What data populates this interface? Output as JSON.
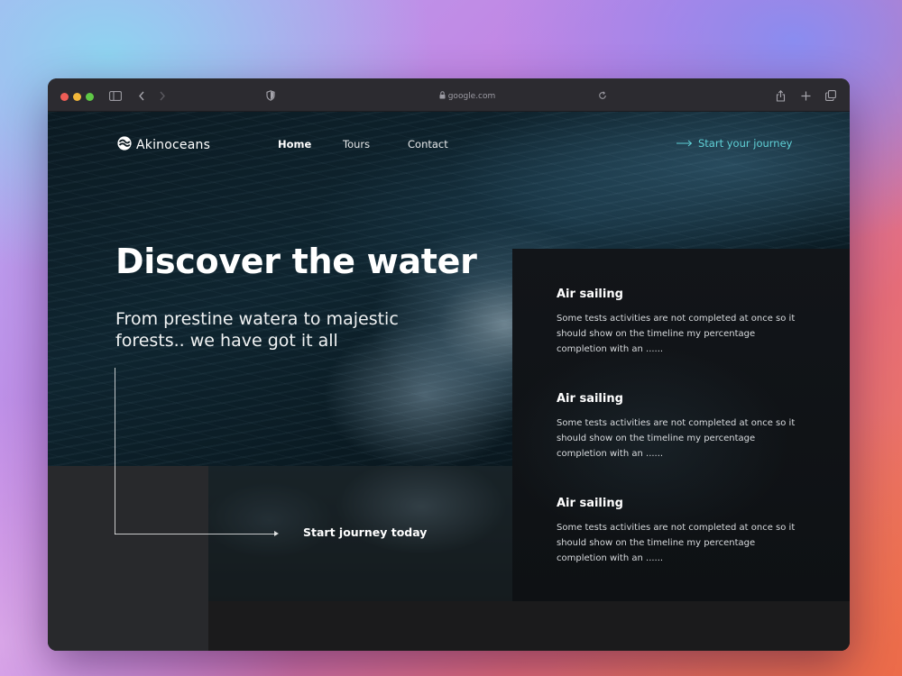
{
  "browser": {
    "url": "google.com",
    "icons": [
      "sidebar-icon",
      "back-icon",
      "forward-icon",
      "shield-icon",
      "lock-icon",
      "reload-icon",
      "share-icon",
      "new-tab-icon",
      "tabs-overview-icon"
    ]
  },
  "site": {
    "brand": "Akinoceans",
    "nav": {
      "home": "Home",
      "tours": "Tours",
      "contact": "Contact"
    },
    "cta_top": "Start your journey",
    "hero_title": "Discover the water",
    "hero_subtitle": "From prestine watera to majestic forests.. we have got it all",
    "start_link": "Start journey today",
    "activities": [
      {
        "title": "Air sailing",
        "text": "Some tests activities are not completed at once so it should show on the timeline my percentage completion with an ......"
      },
      {
        "title": "Air sailing",
        "text": "Some tests activities are not completed at once so it should show on the timeline my percentage completion with an ......"
      },
      {
        "title": "Air sailing",
        "text": "Some tests activities are not completed at once so it should show on the timeline my percentage completion with an ......"
      }
    ]
  },
  "colors": {
    "accent": "#5fd0d6",
    "window_bg": "#151618",
    "titlebar": "#2c2b30"
  }
}
